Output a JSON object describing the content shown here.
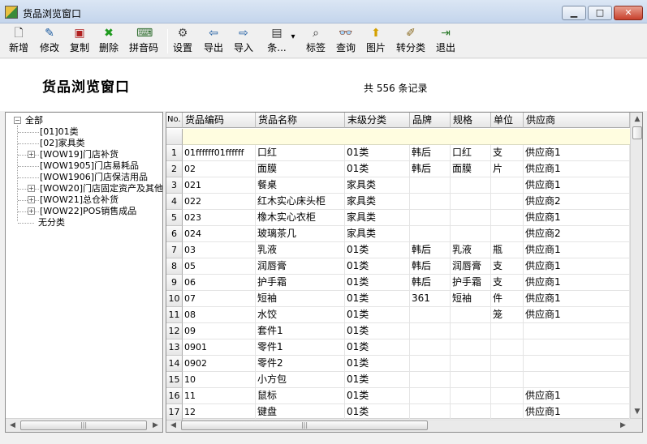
{
  "window": {
    "title": "货品浏览窗口",
    "min_label": "▁",
    "max_label": "□",
    "close_label": "✕"
  },
  "toolbar": {
    "items": [
      {
        "label": "新增",
        "icon": "new-doc-icon",
        "glyph": "🗋",
        "color": "#222222"
      },
      {
        "label": "修改",
        "icon": "edit-icon",
        "glyph": "✎",
        "color": "#1a5aa0"
      },
      {
        "label": "复制",
        "icon": "copy-stamp-icon",
        "glyph": "▣",
        "color": "#b02020"
      },
      {
        "label": "删除",
        "icon": "delete-x-icon",
        "glyph": "✖",
        "color": "#1e9a1e"
      },
      {
        "label": "拼音码",
        "icon": "pinyin-icon",
        "glyph": "⌨",
        "color": "#2a6a2a"
      },
      {
        "label": "设置",
        "icon": "settings-icon",
        "glyph": "⚙",
        "color": "#444444"
      },
      {
        "label": "导出",
        "icon": "export-icon",
        "glyph": "⇦",
        "color": "#1a5aa0"
      },
      {
        "label": "导入",
        "icon": "import-icon",
        "glyph": "⇨",
        "color": "#1a5aa0"
      },
      {
        "label": "条...",
        "icon": "barcode-icon",
        "glyph": "▤",
        "color": "#333333"
      },
      {
        "label": "标签",
        "icon": "label-icon",
        "glyph": "⌕",
        "color": "#333333"
      },
      {
        "label": "查询",
        "icon": "binoculars-icon",
        "glyph": "👓",
        "color": "#222222"
      },
      {
        "label": "图片",
        "icon": "picture-icon",
        "glyph": "⬆",
        "color": "#d4a000"
      },
      {
        "label": "转分类",
        "icon": "broom-icon",
        "glyph": "✐",
        "color": "#8a6a20"
      },
      {
        "label": "退出",
        "icon": "exit-door-icon",
        "glyph": "⇥",
        "color": "#2a7a2a"
      }
    ],
    "dropdown_glyph": "▾"
  },
  "header": {
    "title": "货品浏览窗口",
    "record_count": "共 556 条记录"
  },
  "tree": {
    "root": {
      "label": "全部",
      "expander": "−"
    },
    "items": [
      {
        "label": "[01]01类",
        "expandable": false
      },
      {
        "label": "[02]家具类",
        "expandable": false
      },
      {
        "label": "[WOW19]门店补货",
        "expandable": true
      },
      {
        "label": "[WOW1905]门店易耗品",
        "expandable": false
      },
      {
        "label": "[WOW1906]门店保洁用品",
        "expandable": false
      },
      {
        "label": "[WOW20]门店固定资产及其他",
        "expandable": true
      },
      {
        "label": "[WOW21]总仓补货",
        "expandable": true
      },
      {
        "label": "[WOW22]POS销售成品",
        "expandable": true
      },
      {
        "label": "无分类",
        "expandable": false,
        "root_level": true
      }
    ],
    "expander_plus": "+",
    "scroll_left": "◀",
    "scroll_right": "▶",
    "thumb_grip": "|||"
  },
  "grid": {
    "columns": [
      "No.",
      "货品编码",
      "货品名称",
      "末级分类",
      "品牌",
      "规格",
      "单位",
      "供应商"
    ],
    "current_row_marker": "▸",
    "rows": [
      {
        "no": "1",
        "code": "01ffffff01ffffff",
        "name": "口红",
        "category": "01类",
        "brand": "韩后",
        "spec": "口红",
        "unit": "支",
        "supplier": "供应商1"
      },
      {
        "no": "2",
        "code": "02",
        "name": "面膜",
        "category": "01类",
        "brand": "韩后",
        "spec": "面膜",
        "unit": "片",
        "supplier": "供应商1"
      },
      {
        "no": "3",
        "code": "021",
        "name": "餐桌",
        "category": "家具类",
        "brand": "",
        "spec": "",
        "unit": "",
        "supplier": "供应商1"
      },
      {
        "no": "4",
        "code": "022",
        "name": "红木实心床头柜",
        "category": "家具类",
        "brand": "",
        "spec": "",
        "unit": "",
        "supplier": "供应商2"
      },
      {
        "no": "5",
        "code": "023",
        "name": "橡木实心衣柜",
        "category": "家具类",
        "brand": "",
        "spec": "",
        "unit": "",
        "supplier": "供应商1"
      },
      {
        "no": "6",
        "code": "024",
        "name": "玻璃茶几",
        "category": "家具类",
        "brand": "",
        "spec": "",
        "unit": "",
        "supplier": "供应商2"
      },
      {
        "no": "7",
        "code": "03",
        "name": "乳液",
        "category": "01类",
        "brand": "韩后",
        "spec": "乳液",
        "unit": "瓶",
        "supplier": "供应商1"
      },
      {
        "no": "8",
        "code": "05",
        "name": "润唇膏",
        "category": "01类",
        "brand": "韩后",
        "spec": "润唇膏",
        "unit": "支",
        "supplier": "供应商1"
      },
      {
        "no": "9",
        "code": "06",
        "name": "护手霜",
        "category": "01类",
        "brand": "韩后",
        "spec": "护手霜",
        "unit": "支",
        "supplier": "供应商1"
      },
      {
        "no": "10",
        "code": "07",
        "name": "短袖",
        "category": "01类",
        "brand": "361",
        "spec": "短袖",
        "unit": "件",
        "supplier": "供应商1"
      },
      {
        "no": "11",
        "code": "08",
        "name": "水饺",
        "category": "01类",
        "brand": "",
        "spec": "",
        "unit": "笼",
        "supplier": "供应商1"
      },
      {
        "no": "12",
        "code": "09",
        "name": "套件1",
        "category": "01类",
        "brand": "",
        "spec": "",
        "unit": "",
        "supplier": ""
      },
      {
        "no": "13",
        "code": "0901",
        "name": "零件1",
        "category": "01类",
        "brand": "",
        "spec": "",
        "unit": "",
        "supplier": ""
      },
      {
        "no": "14",
        "code": "0902",
        "name": "零件2",
        "category": "01类",
        "brand": "",
        "spec": "",
        "unit": "",
        "supplier": ""
      },
      {
        "no": "15",
        "code": "10",
        "name": "小方包",
        "category": "01类",
        "brand": "",
        "spec": "",
        "unit": "",
        "supplier": ""
      },
      {
        "no": "16",
        "code": "11",
        "name": "鼠标",
        "category": "01类",
        "brand": "",
        "spec": "",
        "unit": "",
        "supplier": "供应商1"
      },
      {
        "no": "17",
        "code": "12",
        "name": "键盘",
        "category": "01类",
        "brand": "",
        "spec": "",
        "unit": "",
        "supplier": "供应商1"
      }
    ],
    "scroll_up": "▲",
    "scroll_down": "▼",
    "scroll_left": "◀",
    "scroll_right": "▶",
    "thumb_grip": "|||"
  }
}
